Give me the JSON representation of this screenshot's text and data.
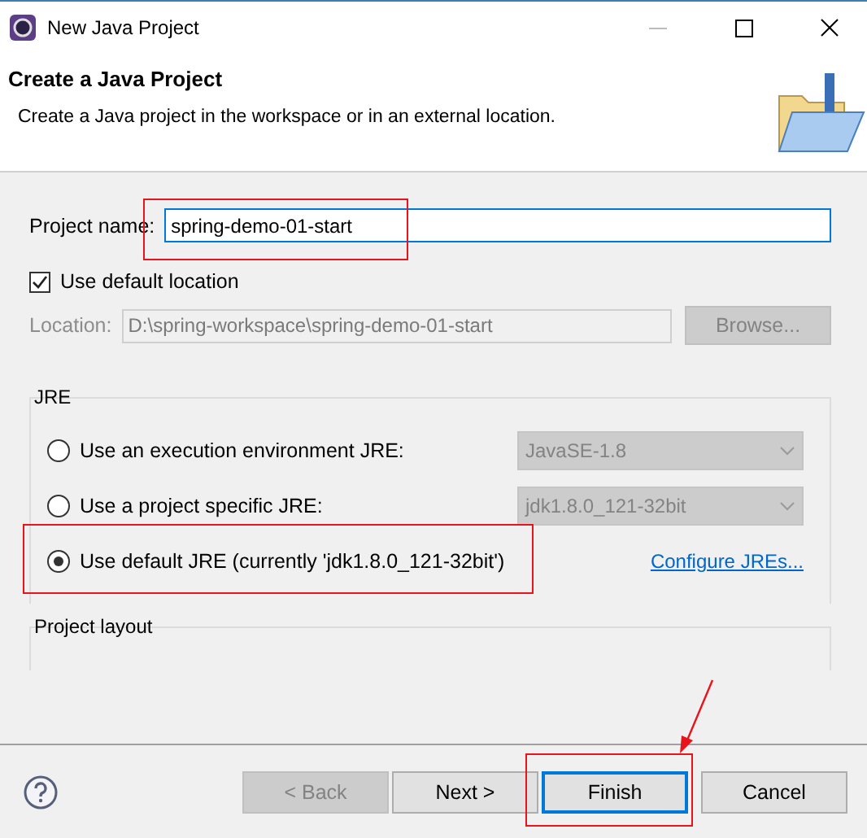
{
  "window": {
    "title": "New Java Project"
  },
  "header": {
    "title": "Create a Java Project",
    "description": "Create a Java project in the workspace or in an external location."
  },
  "project_name": {
    "label": "Project name:",
    "value": "spring-demo-01-start"
  },
  "default_location": {
    "label": "Use default location",
    "checked": true
  },
  "location": {
    "label": "Location:",
    "value": "D:\\spring-workspace\\spring-demo-01-start",
    "disabled": true,
    "button": "Browse..."
  },
  "jre": {
    "title": "JRE",
    "options": [
      {
        "label": "Use an execution environment JRE:",
        "selected": false,
        "kind": "combo",
        "combo": "JavaSE-1.8"
      },
      {
        "label": "Use a project specific JRE:",
        "selected": false,
        "kind": "combo",
        "combo": "jdk1.8.0_121-32bit"
      },
      {
        "label": "Use default JRE (currently 'jdk1.8.0_121-32bit')",
        "selected": true,
        "kind": "link",
        "link": "Configure JREs..."
      }
    ]
  },
  "project_layout": {
    "title": "Project layout"
  },
  "buttons": [
    {
      "label": "< Back",
      "disabled": true,
      "default": false
    },
    {
      "label": "Next >",
      "disabled": false,
      "default": false
    },
    {
      "label": "Finish",
      "disabled": false,
      "default": true
    },
    {
      "label": "Cancel",
      "disabled": false,
      "default": false
    }
  ]
}
